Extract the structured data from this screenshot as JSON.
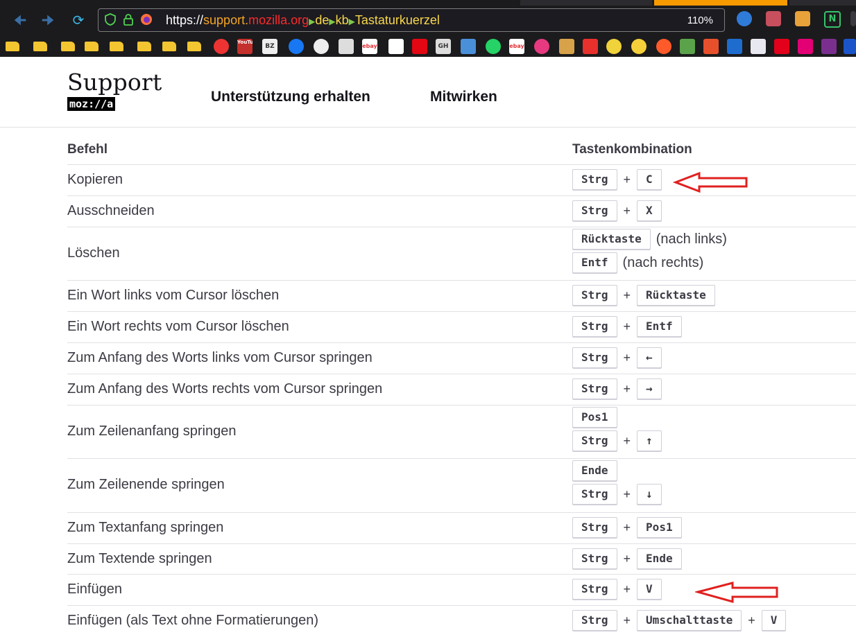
{
  "browser": {
    "url_scheme": "https://",
    "url_domain_1": "support.",
    "url_domain_2": "mozilla.org",
    "url_path": [
      "de",
      "kb",
      "Tastaturkuerzel"
    ],
    "zoom": "110%"
  },
  "bookmarks": [
    "YouTube",
    "BZ",
    "GH",
    "ebay",
    "ebay"
  ],
  "site": {
    "logo_word": "Support",
    "logo_sub": "moz://a",
    "nav": [
      "Unterstützung erhalten",
      "Mitwirken"
    ]
  },
  "table": {
    "header_command": "Befehl",
    "header_keys": "Tastenkombination",
    "rows": [
      {
        "command": "Kopieren",
        "lines": [
          {
            "keys": [
              "Strg",
              "C"
            ]
          }
        ]
      },
      {
        "command": "Ausschneiden",
        "lines": [
          {
            "keys": [
              "Strg",
              "X"
            ]
          }
        ]
      },
      {
        "command": "Löschen",
        "lines": [
          {
            "keys": [
              "Rücktaste"
            ],
            "note": "(nach links)"
          },
          {
            "keys": [
              "Entf"
            ],
            "note": "(nach rechts)"
          }
        ]
      },
      {
        "command": "Ein Wort links vom Cursor löschen",
        "lines": [
          {
            "keys": [
              "Strg",
              "Rücktaste"
            ]
          }
        ]
      },
      {
        "command": "Ein Wort rechts vom Cursor löschen",
        "lines": [
          {
            "keys": [
              "Strg",
              "Entf"
            ]
          }
        ]
      },
      {
        "command": "Zum Anfang des Worts links vom Cursor springen",
        "lines": [
          {
            "keys": [
              "Strg",
              "←"
            ]
          }
        ]
      },
      {
        "command": "Zum Anfang des Worts rechts vom Cursor springen",
        "lines": [
          {
            "keys": [
              "Strg",
              "→"
            ]
          }
        ]
      },
      {
        "command": "Zum Zeilenanfang springen",
        "lines": [
          {
            "keys": [
              "Pos1"
            ]
          },
          {
            "keys": [
              "Strg",
              "↑"
            ]
          }
        ]
      },
      {
        "command": "Zum Zeilenende springen",
        "lines": [
          {
            "keys": [
              "Ende"
            ]
          },
          {
            "keys": [
              "Strg",
              "↓"
            ]
          }
        ]
      },
      {
        "command": "Zum Textanfang springen",
        "lines": [
          {
            "keys": [
              "Strg",
              "Pos1"
            ]
          }
        ]
      },
      {
        "command": "Zum Textende springen",
        "lines": [
          {
            "keys": [
              "Strg",
              "Ende"
            ]
          }
        ]
      },
      {
        "command": "Einfügen",
        "lines": [
          {
            "keys": [
              "Strg",
              "V"
            ]
          }
        ]
      },
      {
        "command": "Einfügen (als Text ohne Formatierungen)",
        "lines": [
          {
            "keys": [
              "Strg",
              "Umschalttaste",
              "V"
            ]
          }
        ]
      }
    ]
  },
  "annotation_color": "#e02020"
}
